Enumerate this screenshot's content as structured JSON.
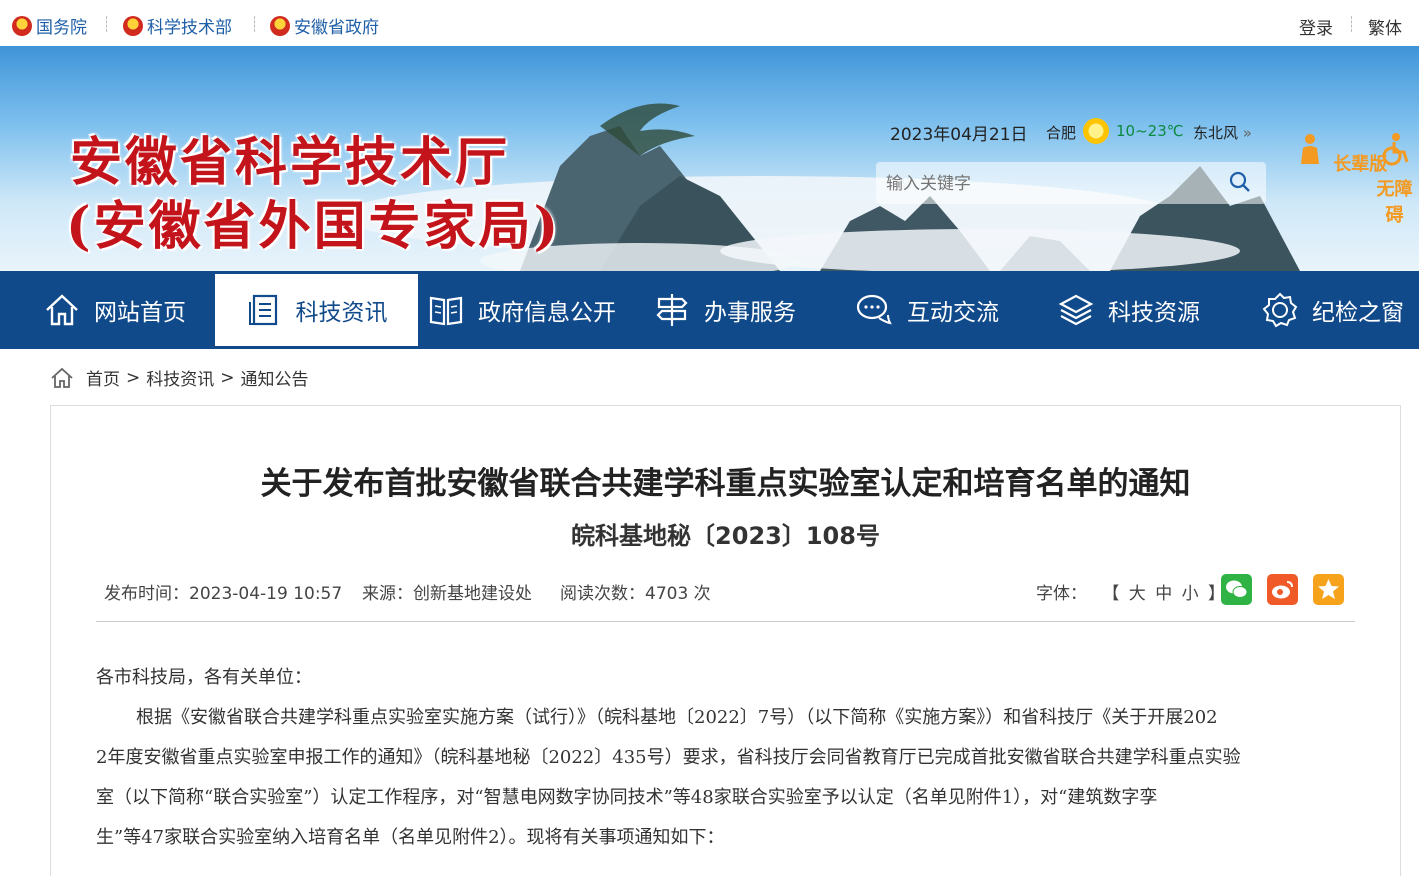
{
  "topbar": {
    "links": [
      "国务院",
      "科学技术部",
      "安徽省政府"
    ],
    "login": "登录",
    "traditional": "繁体"
  },
  "banner": {
    "title_line1": "安徽省科学技术厅",
    "title_line2": "(安徽省外国专家局)",
    "date": "2023年04月21日",
    "city": "合肥",
    "temperature": "10~23℃",
    "wind": "东北风",
    "wind_more": "»",
    "search_placeholder": "输入关键字",
    "elder_label": "长辈版",
    "accessible_label": "无障碍",
    "colors": {
      "title": "#c3141b",
      "temperature": "#0b8a3f",
      "tool": "#f39a22"
    }
  },
  "nav": {
    "items": [
      "网站首页",
      "科技资讯",
      "政府信息公开",
      "办事服务",
      "互动交流",
      "科技资源",
      "纪检之窗"
    ],
    "active_index": 1,
    "colors": {
      "bar": "#114a8a"
    }
  },
  "breadcrumb": {
    "items": [
      "首页",
      "科技资讯",
      "通知公告"
    ],
    "separator": ">"
  },
  "article": {
    "title": "关于发布首批安徽省联合共建学科重点实验室认定和培育名单的通知",
    "doc_number": "皖科基地秘〔2023〕108号",
    "publish_time": "发布时间：2023-04-19 10:57",
    "source": "来源：创新基地建设处",
    "views": "阅读次数：4703 次",
    "font_label": "字体：",
    "font_sizes": "【 大 中 小 】",
    "share_icons": [
      "wechat-icon",
      "weibo-icon",
      "favorite-icon"
    ],
    "salutation": "各市科技局，各有关单位：",
    "body_lines": [
      "根据《安徽省联合共建学科重点实验室实施方案（试行）》（皖科基地〔2022〕7号）（以下简称《实施方案》）和省科技厅《关于开展202",
      "2年度安徽省重点实验室申报工作的通知》（皖科基地秘〔2022〕435号）要求，省科技厅会同省教育厅已完成首批安徽省联合共建学科重点实验",
      "室（以下简称“联合实验室”）认定工作程序，对“智慧电网数字协同技术”等48家联合实验室予以认定（名单见附件1），对“建筑数字孪",
      "生”等47家联合实验室纳入培育名单（名单见附件2）。现将有关事项通知如下："
    ]
  }
}
